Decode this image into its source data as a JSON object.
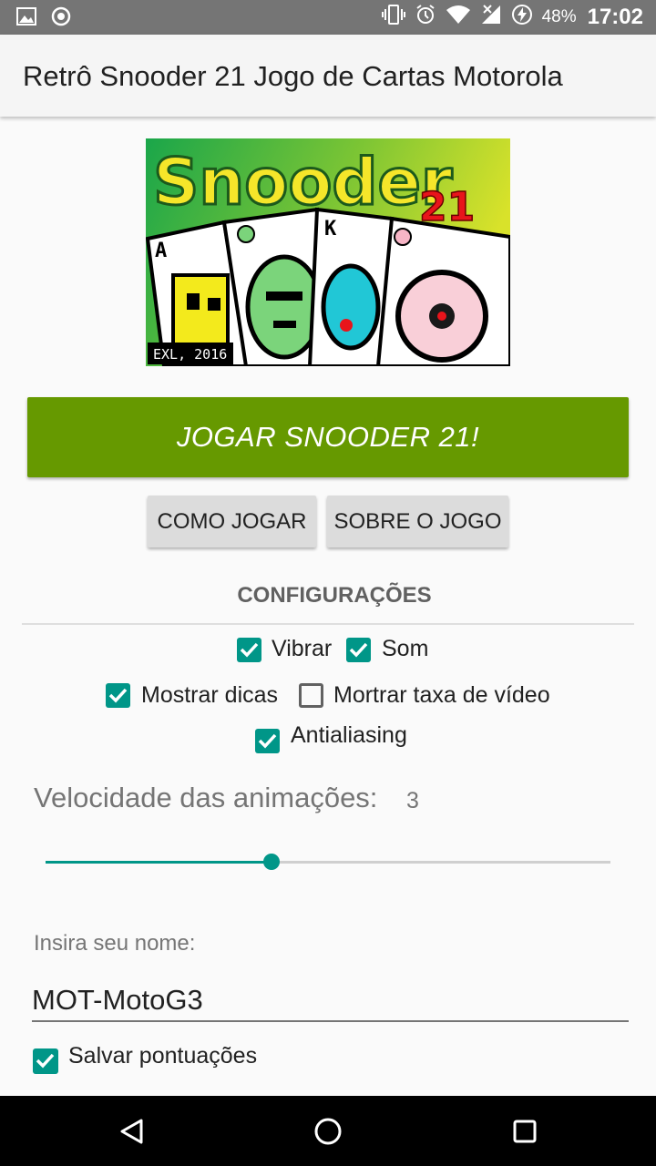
{
  "status_bar": {
    "left_icons": [
      "image-icon",
      "record-icon"
    ],
    "right_icons": [
      "vibrate-icon",
      "alarm-icon",
      "wifi-icon",
      "signal-icon",
      "battery-charging-icon"
    ],
    "battery_percent": "48%",
    "time": "17:02"
  },
  "app_bar": {
    "title": "Retrô Snooder 21 Jogo de Cartas Motorola"
  },
  "banner": {
    "logo_text": "Snooder",
    "logo_number": "21",
    "card_letters": [
      "A",
      "K"
    ],
    "credit": "EXL, 2016"
  },
  "buttons": {
    "play": "JOGAR SNOODER 21!",
    "how_to_play": "COMO JOGAR",
    "about": "SOBRE O JOGO"
  },
  "settings": {
    "title": "CONFIGURAÇÕES",
    "checkboxes": [
      {
        "label": "Vibrar",
        "checked": true
      },
      {
        "label": "Som",
        "checked": true
      },
      {
        "label": "Mostrar dicas",
        "checked": true
      },
      {
        "label": "Mortrar taxa de vídeo",
        "checked": false
      },
      {
        "label": "Antialiasing",
        "checked": true
      }
    ],
    "animation_speed": {
      "label": "Velocidade das animações:",
      "value": "3",
      "slider_fraction": 0.4
    }
  },
  "name": {
    "label": "Insira seu nome:",
    "value": "MOT-MotoG3",
    "save_scores": {
      "label": "Salvar pontuações",
      "checked": true
    }
  },
  "colors": {
    "accent": "#009688",
    "play_button": "#669900",
    "status_bar": "#757575"
  },
  "nav_bar": {
    "icons": [
      "back-icon",
      "home-icon",
      "recents-icon"
    ]
  }
}
